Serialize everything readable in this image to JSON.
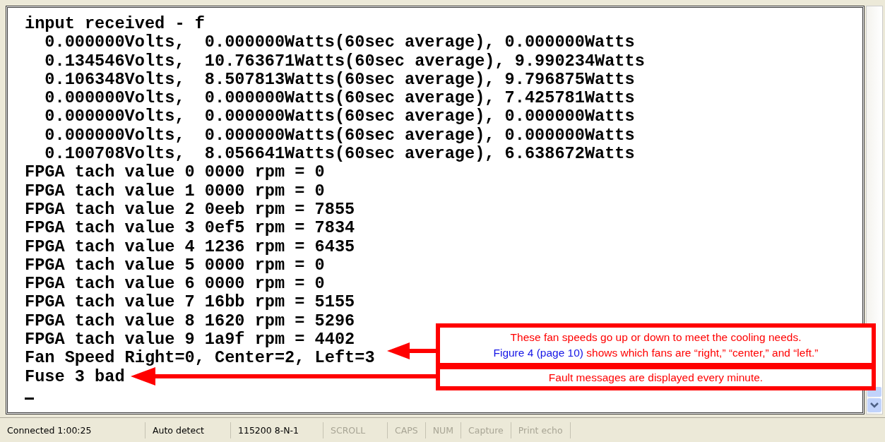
{
  "terminal": {
    "lines": [
      "input received - f",
      "  0.000000Volts,  0.000000Watts(60sec average), 0.000000Watts",
      "  0.134546Volts,  10.763671Watts(60sec average), 9.990234Watts",
      "  0.106348Volts,  8.507813Watts(60sec average), 9.796875Watts",
      "  0.000000Volts,  0.000000Watts(60sec average), 7.425781Watts",
      "  0.000000Volts,  0.000000Watts(60sec average), 0.000000Watts",
      "  0.000000Volts,  0.000000Watts(60sec average), 0.000000Watts",
      "  0.100708Volts,  8.056641Watts(60sec average), 6.638672Watts",
      "FPGA tach value 0 0000 rpm = 0",
      "FPGA tach value 1 0000 rpm = 0",
      "FPGA tach value 2 0eeb rpm = 7855",
      "FPGA tach value 3 0ef5 rpm = 7834",
      "FPGA tach value 4 1236 rpm = 6435",
      "FPGA tach value 5 0000 rpm = 0",
      "FPGA tach value 6 0000 rpm = 0",
      "FPGA tach value 7 16bb rpm = 5155",
      "FPGA tach value 8 1620 rpm = 5296",
      "FPGA tach value 9 1a9f rpm = 4402",
      "Fan Speed Right=0, Center=2, Left=3",
      "Fuse 3 bad"
    ],
    "cursor_visible": true
  },
  "callouts": [
    {
      "lines": [
        [
          {
            "kind": "plain",
            "text": "These fan speeds go up or down to meet the cooling needs."
          }
        ],
        [
          {
            "kind": "link",
            "text": "Figure 4 (page 10)"
          },
          {
            "kind": "plain",
            "text": " shows which fans are “right,” “center,” and “left.”"
          }
        ]
      ]
    },
    {
      "lines": [
        [
          {
            "kind": "plain",
            "text": "Fault messages are displayed every minute."
          }
        ]
      ]
    }
  ],
  "status_bar": [
    {
      "text": "Connected 1:00:25",
      "active": true
    },
    {
      "text": "Auto detect",
      "active": true
    },
    {
      "text": "115200 8-N-1",
      "active": true
    },
    {
      "text": "SCROLL",
      "active": false
    },
    {
      "text": "CAPS",
      "active": false
    },
    {
      "text": "NUM",
      "active": false
    },
    {
      "text": "Capture",
      "active": false
    },
    {
      "text": "Print echo",
      "active": false
    }
  ]
}
